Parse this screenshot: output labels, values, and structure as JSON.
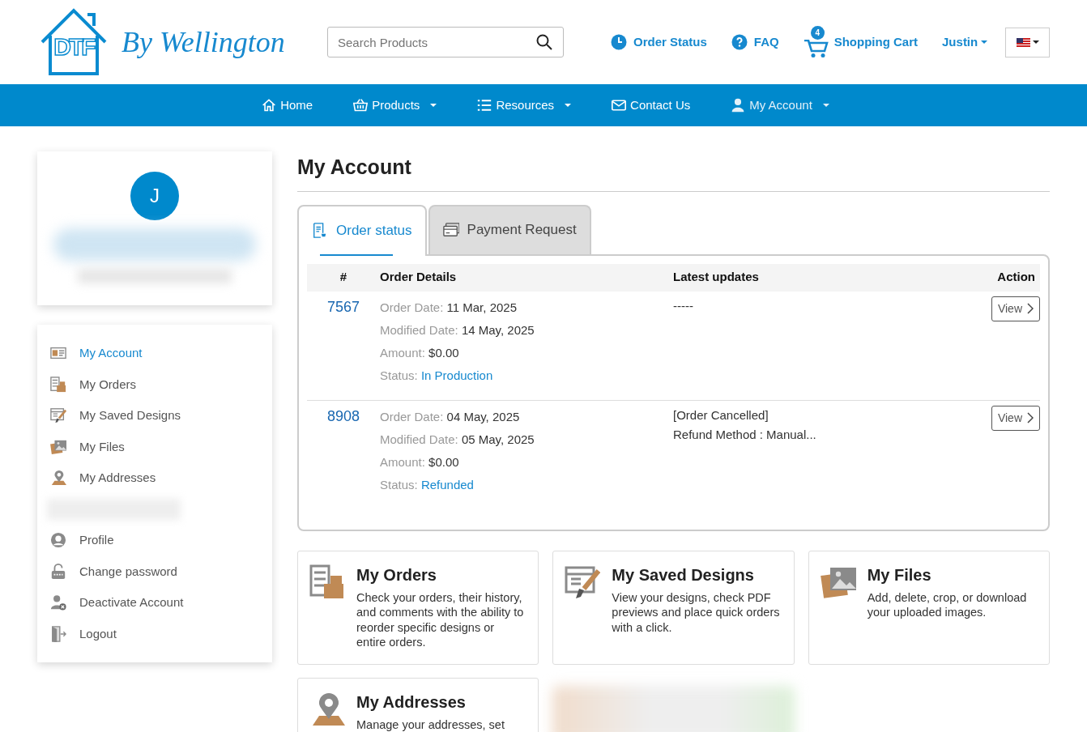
{
  "header": {
    "logo_mark": "DTF",
    "logo_text": "By Wellington",
    "search": {
      "placeholder": "Search Products"
    },
    "links": [
      {
        "kind": "clock",
        "label": "Order Status"
      },
      {
        "kind": "question",
        "label": "FAQ"
      }
    ],
    "cart": {
      "label": "Shopping Cart",
      "count": "4"
    },
    "user": "Justin"
  },
  "nav": [
    {
      "label": "Home",
      "dropdown": false
    },
    {
      "label": "Products",
      "dropdown": true
    },
    {
      "label": "Resources",
      "dropdown": true
    },
    {
      "label": "Contact Us",
      "dropdown": false
    },
    {
      "label": "My Account",
      "dropdown": true
    }
  ],
  "profile": {
    "initial": "J"
  },
  "sidebar": {
    "items": [
      {
        "kind": "link",
        "label": "My Account",
        "selected": true
      },
      {
        "kind": "link",
        "label": "My Orders",
        "selected": false
      },
      {
        "kind": "link",
        "label": "My Saved Designs",
        "selected": false
      },
      {
        "kind": "link",
        "label": "My Files",
        "selected": false
      },
      {
        "kind": "link",
        "label": "My Addresses",
        "selected": false
      },
      {
        "kind": "redacted"
      },
      {
        "kind": "link",
        "label": "Profile",
        "selected": false
      },
      {
        "kind": "link",
        "label": "Change password",
        "selected": false
      },
      {
        "kind": "link",
        "label": "Deactivate Account",
        "selected": false
      },
      {
        "kind": "link",
        "label": "Logout",
        "selected": false
      }
    ]
  },
  "page_title": "My Account",
  "tabs": [
    {
      "label": "Order status",
      "selected": true
    },
    {
      "label": "Payment Request",
      "selected": false
    }
  ],
  "orders": {
    "columns": [
      "#",
      "Order Details",
      "Latest updates",
      "Action"
    ],
    "rows": [
      {
        "number": "7567",
        "details": [
          {
            "label": "Order Date:",
            "value": "11 Mar, 2025",
            "kind": "plain"
          },
          {
            "label": "Modified Date:",
            "value": "14 May, 2025",
            "kind": "plain"
          },
          {
            "label": "Amount:",
            "value": "$0.00",
            "kind": "plain"
          },
          {
            "label": "Status:",
            "value": "In Production",
            "kind": "status"
          }
        ],
        "updates": [
          "-----"
        ],
        "action": "View"
      },
      {
        "number": "8908",
        "details": [
          {
            "label": "Order Date:",
            "value": "04 May, 2025",
            "kind": "plain"
          },
          {
            "label": "Modified Date:",
            "value": "05 May, 2025",
            "kind": "plain"
          },
          {
            "label": "Amount:",
            "value": "$0.00",
            "kind": "plain"
          },
          {
            "label": "Status:",
            "value": "Refunded",
            "kind": "status"
          }
        ],
        "updates": [
          "[Order Cancelled]",
          "Refund Method : Manual..."
        ],
        "action": "View"
      }
    ]
  },
  "cards": [
    {
      "kind": "card",
      "title": "My Orders",
      "text": "Check your orders, their history, and comments with the ability to reorder specific designs or entire orders."
    },
    {
      "kind": "card",
      "title": "My Saved Designs",
      "text": "View your designs, check PDF previews and place quick orders with a click."
    },
    {
      "kind": "card",
      "title": "My Files",
      "text": "Add, delete, crop, or download your uploaded images."
    },
    {
      "kind": "card",
      "title": "My Addresses",
      "text": "Manage your addresses, set"
    },
    {
      "kind": "redacted"
    }
  ]
}
